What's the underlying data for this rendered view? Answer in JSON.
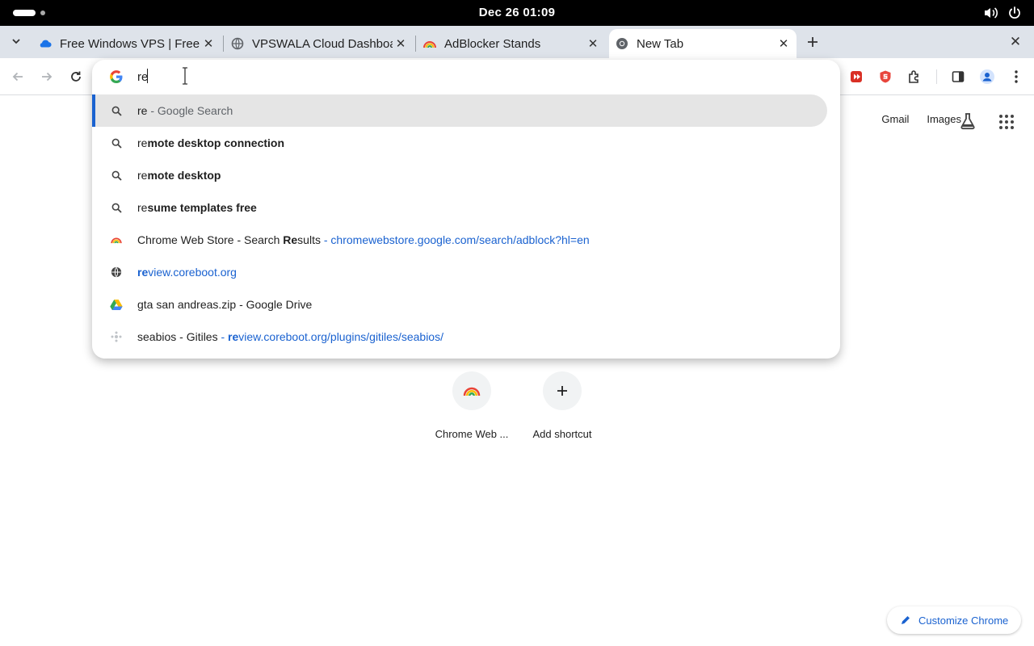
{
  "system": {
    "clock": "Dec 26  01:09"
  },
  "tabs": [
    {
      "title": "Free Windows VPS | Free",
      "favicon": "cloud-icon"
    },
    {
      "title": "VPSWALA Cloud Dashboard",
      "favicon": "globe-icon"
    },
    {
      "title": "AdBlocker Stands",
      "favicon": "rainbow-icon"
    },
    {
      "title": "New Tab",
      "favicon": "chrome-icon",
      "active": true
    }
  ],
  "omnibox": {
    "value": "re",
    "suggestions": [
      {
        "type": "search",
        "bold": "",
        "typed": "re",
        "rest": "",
        "suffix": " - Google Search",
        "selected": true
      },
      {
        "type": "search",
        "typed": "re",
        "rest": "mote desktop connection"
      },
      {
        "type": "search",
        "typed": "re",
        "rest": "mote desktop"
      },
      {
        "type": "search",
        "typed": "re",
        "rest": "sume templates free"
      },
      {
        "type": "history",
        "title_pre": "Chrome Web Store - Search ",
        "title_bold": "Re",
        "title_post": "sults",
        "sep": " - ",
        "url": "chromewebstore.google.com/search/adblock?hl=en"
      },
      {
        "type": "url",
        "url_bold": "re",
        "url_rest": "view.coreboot.org"
      },
      {
        "type": "drive",
        "title": "gta san andreas.zip - Google Drive"
      },
      {
        "type": "history",
        "title_pre": "seabios - Gitiles",
        "sep": " - ",
        "url_bold": "re",
        "url_rest": "view.coreboot.org/plugins/gitiles/seabios/"
      }
    ]
  },
  "ntp": {
    "gmail": "Gmail",
    "images": "Images",
    "shortcuts": [
      {
        "label": "Chrome Web ...",
        "icon": "rainbow-icon"
      },
      {
        "label": "Add shortcut",
        "icon": "plus-icon"
      }
    ],
    "customize": "Customize Chrome"
  },
  "colors": {
    "accent": "#1a62d0",
    "tabstrip": "#dee3ea",
    "selected_row": "#e5e5e5"
  }
}
